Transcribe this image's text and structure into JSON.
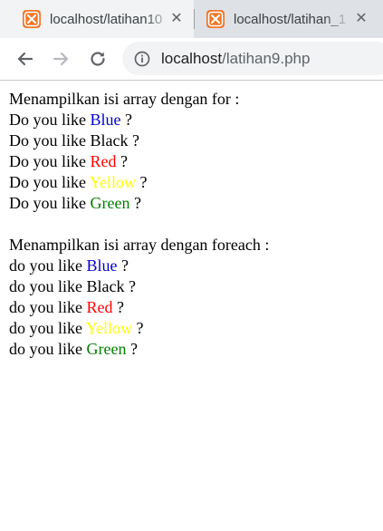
{
  "browser": {
    "tabs": [
      {
        "title": "localhost/latihan10",
        "active": true
      },
      {
        "title": "localhost/latihan_1",
        "active": false
      }
    ],
    "address": {
      "host": "localhost",
      "path": "/latihan9.php"
    }
  },
  "page": {
    "sections": [
      {
        "heading": "Menampilkan isi array dengan for :",
        "lines": [
          {
            "prefix": "Do you like ",
            "color_word": "Blue",
            "color": "#0000cc",
            "suffix": " ?"
          },
          {
            "prefix": "Do you like ",
            "color_word": "Black",
            "color": "#000000",
            "suffix": " ?"
          },
          {
            "prefix": "Do you like ",
            "color_word": "Red",
            "color": "#ff0000",
            "suffix": " ?"
          },
          {
            "prefix": "Do you like ",
            "color_word": "Yellow",
            "color": "#ffff00",
            "suffix": " ?"
          },
          {
            "prefix": "Do you like ",
            "color_word": "Green",
            "color": "#008000",
            "suffix": " ?"
          }
        ]
      },
      {
        "heading": "Menampilkan isi array dengan foreach :",
        "lines": [
          {
            "prefix": "do you like ",
            "color_word": "Blue",
            "color": "#0000cc",
            "suffix": " ?"
          },
          {
            "prefix": "do you like ",
            "color_word": "Black",
            "color": "#000000",
            "suffix": " ?"
          },
          {
            "prefix": "do you like ",
            "color_word": "Red",
            "color": "#ff0000",
            "suffix": " ?"
          },
          {
            "prefix": "do you like ",
            "color_word": "Yellow",
            "color": "#ffff00",
            "suffix": " ?"
          },
          {
            "prefix": "do you like ",
            "color_word": "Green",
            "color": "#008000",
            "suffix": " ?"
          }
        ]
      }
    ]
  },
  "icons": {
    "favicon": "xampp-favicon-icon",
    "tab_close": "close-icon",
    "back": "back-arrow-icon",
    "forward": "forward-arrow-icon",
    "reload": "reload-icon",
    "site_info": "info-icon"
  }
}
